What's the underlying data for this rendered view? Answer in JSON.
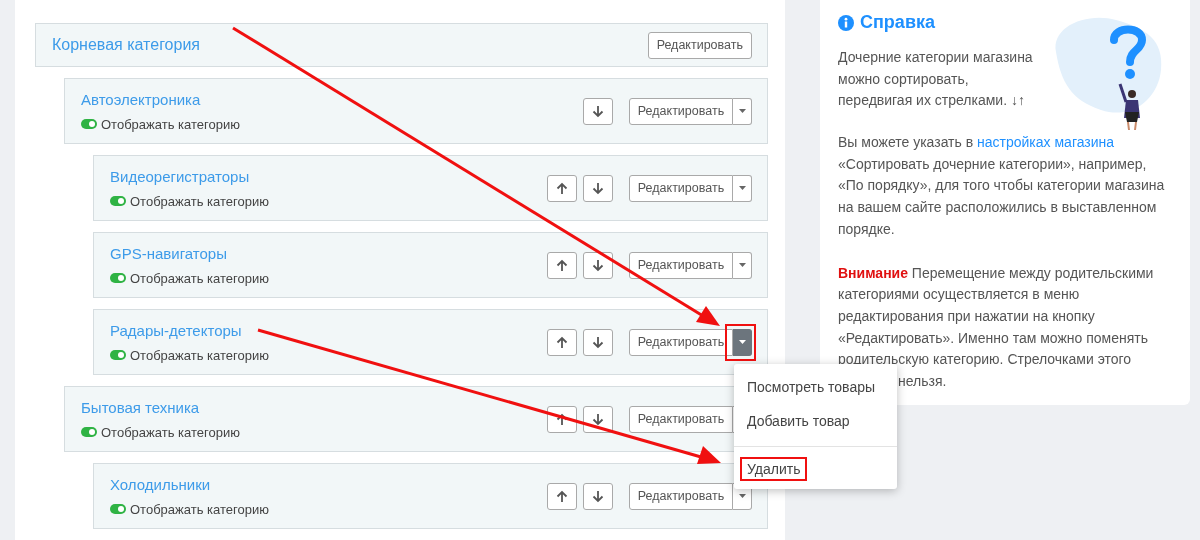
{
  "root": {
    "name": "Корневая категория",
    "edit_label": "Редактировать",
    "children": [
      {
        "name": "Автоэлектроника",
        "visible": true,
        "visible_label": "Отображать категорию",
        "can_move_up": false,
        "can_move_down": true,
        "edit_label": "Редактировать",
        "menu_open": false,
        "children": [
          {
            "name": "Видеорегистраторы",
            "visible": true,
            "visible_label": "Отображать категорию",
            "can_move_up": true,
            "can_move_down": true,
            "edit_label": "Редактировать",
            "menu_open": false
          },
          {
            "name": "GPS-навигаторы",
            "visible": true,
            "visible_label": "Отображать категорию",
            "can_move_up": true,
            "can_move_down": true,
            "edit_label": "Редактировать",
            "menu_open": false
          },
          {
            "name": "Радары-детекторы",
            "visible": true,
            "visible_label": "Отображать категорию",
            "can_move_up": true,
            "can_move_down": true,
            "edit_label": "Редактировать",
            "menu_open": true
          }
        ]
      },
      {
        "name": "Бытовая техника",
        "visible": true,
        "visible_label": "Отображать категорию",
        "can_move_up": true,
        "can_move_down": true,
        "edit_label": "Редактировать",
        "menu_open": false,
        "children": [
          {
            "name": "Холодильники",
            "visible": true,
            "visible_label": "Отображать категорию",
            "can_move_up": true,
            "can_move_down": true,
            "edit_label": "Редактировать",
            "menu_open": false
          }
        ]
      }
    ]
  },
  "dropdown_menu": [
    {
      "label": "Посмотреть товары",
      "highlighted": false
    },
    {
      "label": "Добавить товар",
      "highlighted": false,
      "divider_after": true
    },
    {
      "label": "Удалить",
      "highlighted": true
    }
  ],
  "help": {
    "title": "Справка",
    "intro": "Дочерние категории магазина можно сортировать, передвигая их стрелками. **↓↑**",
    "settings_before": "Вы можете указать в ",
    "settings_link": "настройках магазина",
    "settings_after": " «Сортировать дочерние категории», например, «По порядку», для того чтобы категории магазина на вашем сайте расположились в выставленном порядке.",
    "warning_label": "Внимание",
    "warning_text": " Перемещение между родительскими категориями осуществляется в меню редактирования при нажатии на кнопку «Редактировать». Именно там можно поменять родительскую категорию. Стрелочками этого",
    "warning_tail": "нельзя."
  }
}
